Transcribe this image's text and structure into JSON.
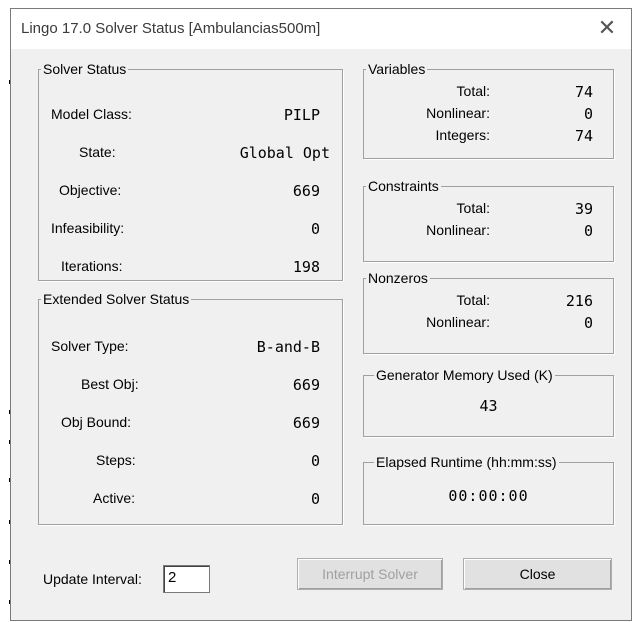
{
  "window": {
    "title": "Lingo 17.0 Solver Status [Ambulancias500m]",
    "close_glyph": "✕"
  },
  "solver_status": {
    "legend": "Solver Status",
    "rows": [
      {
        "label": "Model Class:",
        "value": "PILP"
      },
      {
        "label": "State:",
        "value": "Global Opt"
      },
      {
        "label": "Objective:",
        "value": "669"
      },
      {
        "label": "Infeasibility:",
        "value": "0"
      },
      {
        "label": "Iterations:",
        "value": "198"
      }
    ]
  },
  "extended_status": {
    "legend": "Extended Solver Status",
    "rows": [
      {
        "label": "Solver Type:",
        "value": "B-and-B"
      },
      {
        "label": "Best Obj:",
        "value": "669"
      },
      {
        "label": "Obj Bound:",
        "value": "669"
      },
      {
        "label": "Steps:",
        "value": "0"
      },
      {
        "label": "Active:",
        "value": "0"
      }
    ]
  },
  "variables": {
    "legend": "Variables",
    "rows": [
      {
        "label": "Total:",
        "value": "74"
      },
      {
        "label": "Nonlinear:",
        "value": "0"
      },
      {
        "label": "Integers:",
        "value": "74"
      }
    ]
  },
  "constraints": {
    "legend": "Constraints",
    "rows": [
      {
        "label": "Total:",
        "value": "39"
      },
      {
        "label": "Nonlinear:",
        "value": "0"
      }
    ]
  },
  "nonzeros": {
    "legend": "Nonzeros",
    "rows": [
      {
        "label": "Total:",
        "value": "216"
      },
      {
        "label": "Nonlinear:",
        "value": "0"
      }
    ]
  },
  "memory": {
    "legend": "Generator Memory Used (K)",
    "value": "43"
  },
  "runtime": {
    "legend": "Elapsed Runtime (hh:mm:ss)",
    "value": "00:00:00"
  },
  "footer": {
    "update_interval_label": "Update Interval:",
    "update_interval_value": "2",
    "interrupt_label": "Interrupt Solver",
    "close_label": "Close"
  }
}
